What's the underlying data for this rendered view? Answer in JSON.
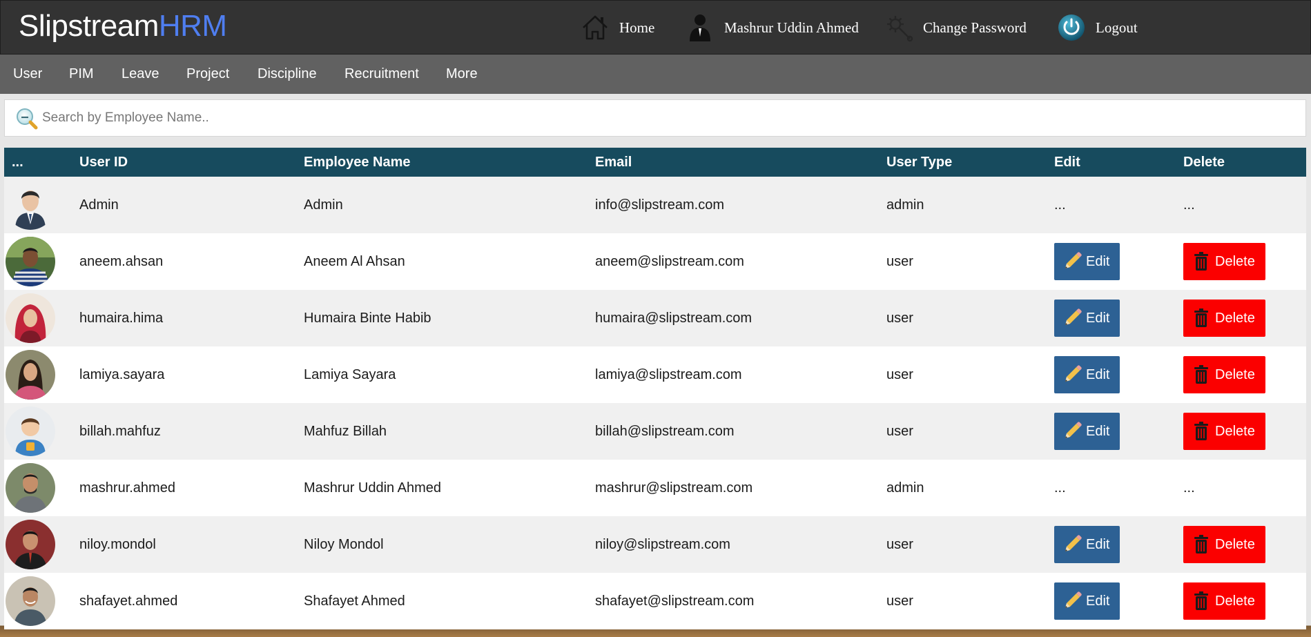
{
  "brand": {
    "part1": "Slipstream",
    "part2": "HRM"
  },
  "toplinks": {
    "home": "Home",
    "user": "Mashrur Uddin Ahmed",
    "change_password": "Change Password",
    "logout": "Logout"
  },
  "nav": [
    "User",
    "PIM",
    "Leave",
    "Project",
    "Discipline",
    "Recruitment",
    "More"
  ],
  "search": {
    "placeholder": "Search by Employee Name.."
  },
  "table": {
    "headers": [
      "...",
      "User ID",
      "Employee Name",
      "Email",
      "User Type",
      "Edit",
      "Delete"
    ],
    "edit_label": "Edit",
    "delete_label": "Delete",
    "rows": [
      {
        "user_id": "Admin",
        "name": "Admin",
        "email": "info@slipstream.com",
        "type": "admin",
        "edit": "...",
        "delete": "...",
        "avatar": "default-male-avatar"
      },
      {
        "user_id": "aneem.ahsan",
        "name": "Aneem Al Ahsan",
        "email": "aneem@slipstream.com",
        "type": "user",
        "avatar": "photo"
      },
      {
        "user_id": "humaira.hima",
        "name": "Humaira Binte Habib",
        "email": "humaira@slipstream.com",
        "type": "user",
        "avatar": "photo"
      },
      {
        "user_id": "lamiya.sayara",
        "name": "Lamiya Sayara",
        "email": "lamiya@slipstream.com",
        "type": "user",
        "avatar": "photo"
      },
      {
        "user_id": "billah.mahfuz",
        "name": "Mahfuz Billah",
        "email": "billah@slipstream.com",
        "type": "user",
        "avatar": "cartoon-avatar"
      },
      {
        "user_id": "mashrur.ahmed",
        "name": "Mashrur Uddin Ahmed",
        "email": "mashrur@slipstream.com",
        "type": "admin",
        "edit": "...",
        "delete": "...",
        "avatar": "photo"
      },
      {
        "user_id": "niloy.mondol",
        "name": "Niloy Mondol",
        "email": "niloy@slipstream.com",
        "type": "user",
        "avatar": "photo"
      },
      {
        "user_id": "shafayet.ahmed",
        "name": "Shafayet Ahmed",
        "email": "shafayet@slipstream.com",
        "type": "user",
        "avatar": "photo"
      }
    ]
  },
  "colors": {
    "topbar": "#333333",
    "navbar": "#616161",
    "brand_accent": "#4f7ef0",
    "table_header": "#174b5e",
    "edit_button": "#2d6194",
    "delete_button": "#fb0000"
  }
}
